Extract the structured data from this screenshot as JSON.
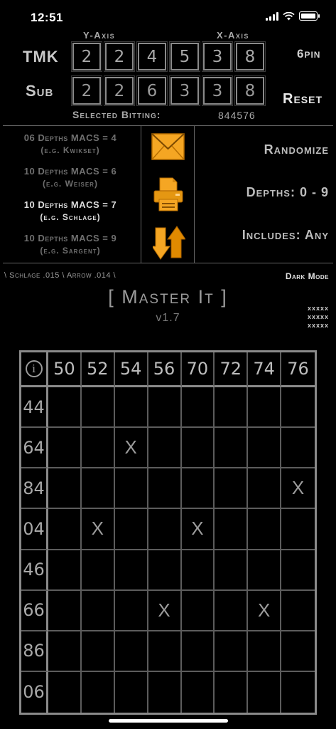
{
  "status": {
    "time": "12:51"
  },
  "axes": {
    "y_label": "Y-Axis",
    "x_label": "X-Axis"
  },
  "rows": {
    "tmk": {
      "label": "TMK",
      "values": [
        "2",
        "2",
        "4",
        "5",
        "3",
        "8"
      ]
    },
    "sub": {
      "label": "Sub",
      "values": [
        "2",
        "2",
        "6",
        "3",
        "3",
        "8"
      ]
    }
  },
  "pin_label": "6pin",
  "reset_label": "Reset",
  "selected": {
    "label": "Selected Bitting:",
    "value": "844576"
  },
  "options": [
    {
      "line1": "06 Depths MACS = 4",
      "line2": "(e.g. Kwikset)",
      "active": false
    },
    {
      "line1": "10 Depths MACS = 6",
      "line2": "(e.g. Weiser)",
      "active": false
    },
    {
      "line1": "10 Depths MACS = 7",
      "line2": "(e.g. Schlage)",
      "active": true
    },
    {
      "line1": "10 Depths MACS = 9",
      "line2": "(e.g. Sargent)",
      "active": false
    }
  ],
  "actions": {
    "randomize": "Randomize",
    "depths": "Depths: 0 - 9",
    "includes": "Includes: Any"
  },
  "icons": {
    "mail": "envelope-icon",
    "print": "printer-icon",
    "sort": "swap-arrows-icon",
    "info": "info-icon"
  },
  "colors": {
    "accent": "#f5a623",
    "bg": "#000000"
  },
  "keyway_text": "\\ Schlage .015 \\ Arrow .014 \\",
  "dark_mode_label": "Dark Mode",
  "title": "[ Master It ]",
  "version": "v1.7",
  "xxxxx": [
    "xxxxx",
    "xxxxx",
    "xxxxx"
  ],
  "grid": {
    "info_symbol": "i",
    "columns": [
      "50",
      "52",
      "54",
      "56",
      "70",
      "72",
      "74",
      "76"
    ],
    "rows": [
      {
        "label": "44",
        "cells": [
          "",
          "",
          "",
          "",
          "",
          "",
          "",
          ""
        ]
      },
      {
        "label": "64",
        "cells": [
          "",
          "",
          "X",
          "",
          "",
          "",
          "",
          ""
        ]
      },
      {
        "label": "84",
        "cells": [
          "",
          "",
          "",
          "",
          "",
          "",
          "",
          "X"
        ]
      },
      {
        "label": "04",
        "cells": [
          "",
          "X",
          "",
          "",
          "X",
          "",
          "",
          ""
        ]
      },
      {
        "label": "46",
        "cells": [
          "",
          "",
          "",
          "",
          "",
          "",
          "",
          ""
        ]
      },
      {
        "label": "66",
        "cells": [
          "",
          "",
          "",
          "X",
          "",
          "",
          "X",
          ""
        ]
      },
      {
        "label": "86",
        "cells": [
          "",
          "",
          "",
          "",
          "",
          "",
          "",
          ""
        ]
      },
      {
        "label": "06",
        "cells": [
          "",
          "",
          "",
          "",
          "",
          "",
          "",
          ""
        ]
      }
    ]
  }
}
